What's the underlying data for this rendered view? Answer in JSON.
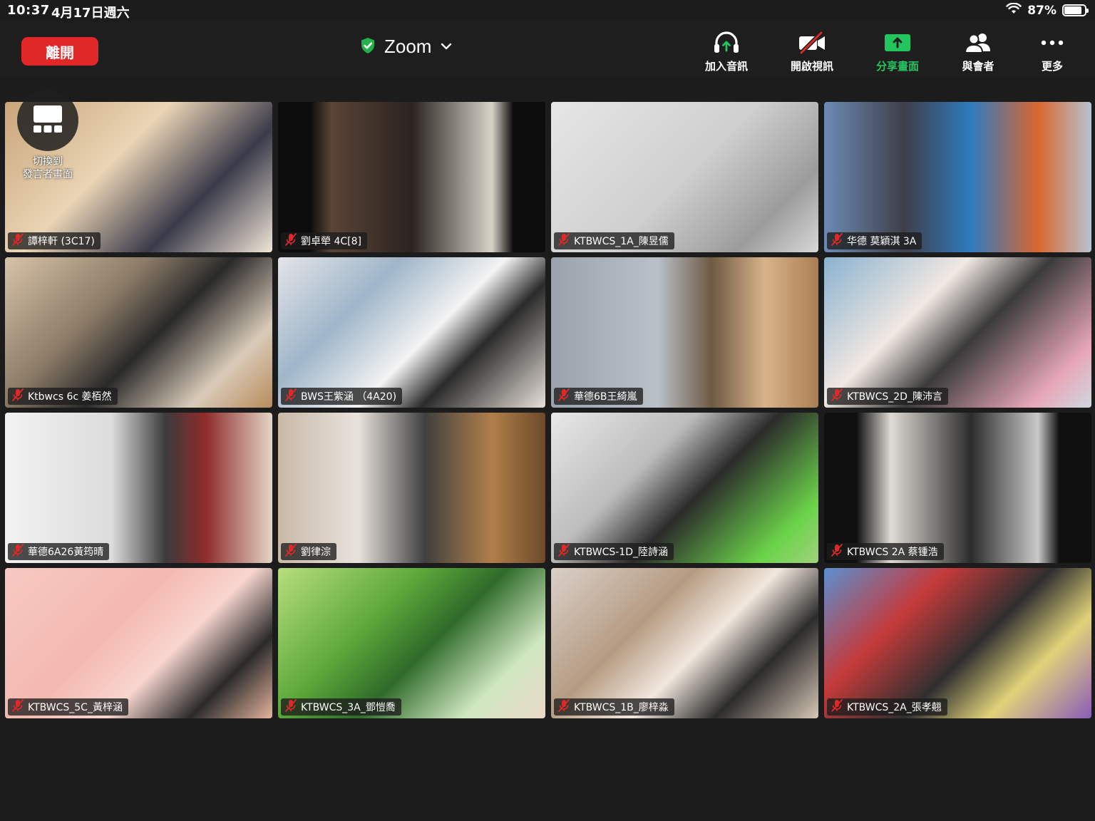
{
  "status_bar": {
    "time": "10:37",
    "date": "4月17日週六",
    "battery": "87%",
    "battery_level": 0.87
  },
  "toolbar": {
    "leave_label": "離開",
    "meeting_title": "Zoom",
    "join_audio_label": "加入音訊",
    "start_video_label": "開啟視訊",
    "share_screen_label": "分享畫面",
    "participants_label": "與會者",
    "more_label": "更多"
  },
  "switch_view": {
    "line1": "切換到",
    "line2": "發言者畫面"
  },
  "colors": {
    "leave_red": "#e02828",
    "share_green": "#22c55e",
    "mic_off_red": "#e02828",
    "shield_green": "#22b14c"
  },
  "participants": [
    {
      "name": "譚梓軒 (3C17)",
      "bg": "linear-gradient(135deg,#c9a57a 0%,#e9d4b4 40%,#3a3a4a 70%,#f0e6d6 100%)"
    },
    {
      "name": "劉卓犖 4C[8]",
      "bg": "linear-gradient(90deg,#0c0c0c 0%,#0c0c0c 12%,#5a4436 20%,#2a2320 50%,#d7d2c8 80%,#0c0c0c 88%,#0c0c0c 100%)"
    },
    {
      "name": "KTBWCS_1A_陳昱儒",
      "bg": "linear-gradient(135deg,#e6e6e6 0%,#cfcfcf 50%,#9c9c9c 80%,#d8d8d8 100%)"
    },
    {
      "name": "华德 莫穎淇 3A",
      "bg": "linear-gradient(90deg,#6b8bb3 0%,#3f3f4a 30%,#2f7bbf 55%,#d9662f 80%,#b7c3cf 100%)"
    },
    {
      "name": "Ktbwcs 6c 姜栢然",
      "bg": "linear-gradient(135deg,#d7c3a8 0%,#8a7a66 35%,#2a2a2a 55%,#d9cbb9 80%,#b88c5a 100%)"
    },
    {
      "name": "BWS王紫涵 （4A20)",
      "bg": "linear-gradient(135deg,#e4e4e8 0%,#9fb6c9 30%,#f3f3f3 55%,#2b2b2b 70%,#e8e1da 100%)"
    },
    {
      "name": "華德6B王綺嵐",
      "bg": "linear-gradient(90deg,#9aa3ad 0%,#b9c0c8 40%,#6e5a44 60%,#d9b38a 80%,#a97e52 100%)"
    },
    {
      "name": "KTBWCS_2D_陳沛言",
      "bg": "linear-gradient(135deg,#8ab2d0 0%,#f1e8e2 35%,#3b3b3b 55%,#e8a7b9 85%,#cfd8de 100%)"
    },
    {
      "name": "華德6A26黃筠晴",
      "bg": "linear-gradient(90deg,#f2f2f2 0%,#dcdcdc 40%,#3b3b3b 60%,#8f2b2b 75%,#e3d6c6 100%)"
    },
    {
      "name": "劉律淙",
      "bg": "linear-gradient(90deg,#c9b9a8 0%,#e8e2dc 30%,#404040 55%,#b07f4a 80%,#6b4a2b 100%)"
    },
    {
      "name": "KTBWCS-1D_陸詩涵",
      "bg": "linear-gradient(135deg,#e8e8e8 0%,#bcbcbc 35%,#2b2b2b 55%,#6bd34a 85%,#9fd27d 100%)"
    },
    {
      "name": "KTBWCS 2A 蔡锺浩",
      "bg": "linear-gradient(90deg,#0f0f0f 0%,#0f0f0f 12%,#dedad4 25%,#2c2c2c 55%,#c9c9c9 80%,#0f0f0f 88%,#0f0f0f 100%)"
    },
    {
      "name": "KTBWCS_5C_黃梓涵",
      "bg": "linear-gradient(135deg,#f6c9c3 0%,#f3b8b0 40%,#f7d6cf 60%,#2a2a2a 80%,#e5b49d 100%)"
    },
    {
      "name": "KTBWCS_3A_鄧愷喬",
      "bg": "linear-gradient(135deg,#b7de7e 0%,#5da83a 35%,#2f6b2a 55%,#cfe6c0 80%,#e9d8c8 100%)"
    },
    {
      "name": "KTBWCS_1B_廖梓淼",
      "bg": "linear-gradient(135deg,#d9d0c8 0%,#b59b82 35%,#f2e8de 55%,#2c2c2c 75%,#d7c7b6 100%)"
    },
    {
      "name": "KTBWCS_2A_張孝翹",
      "bg": "linear-gradient(135deg,#5b8fd1 0%,#c43a3a 30%,#2f2f2f 55%,#e1d27a 75%,#8a5cb8 100%)"
    }
  ]
}
